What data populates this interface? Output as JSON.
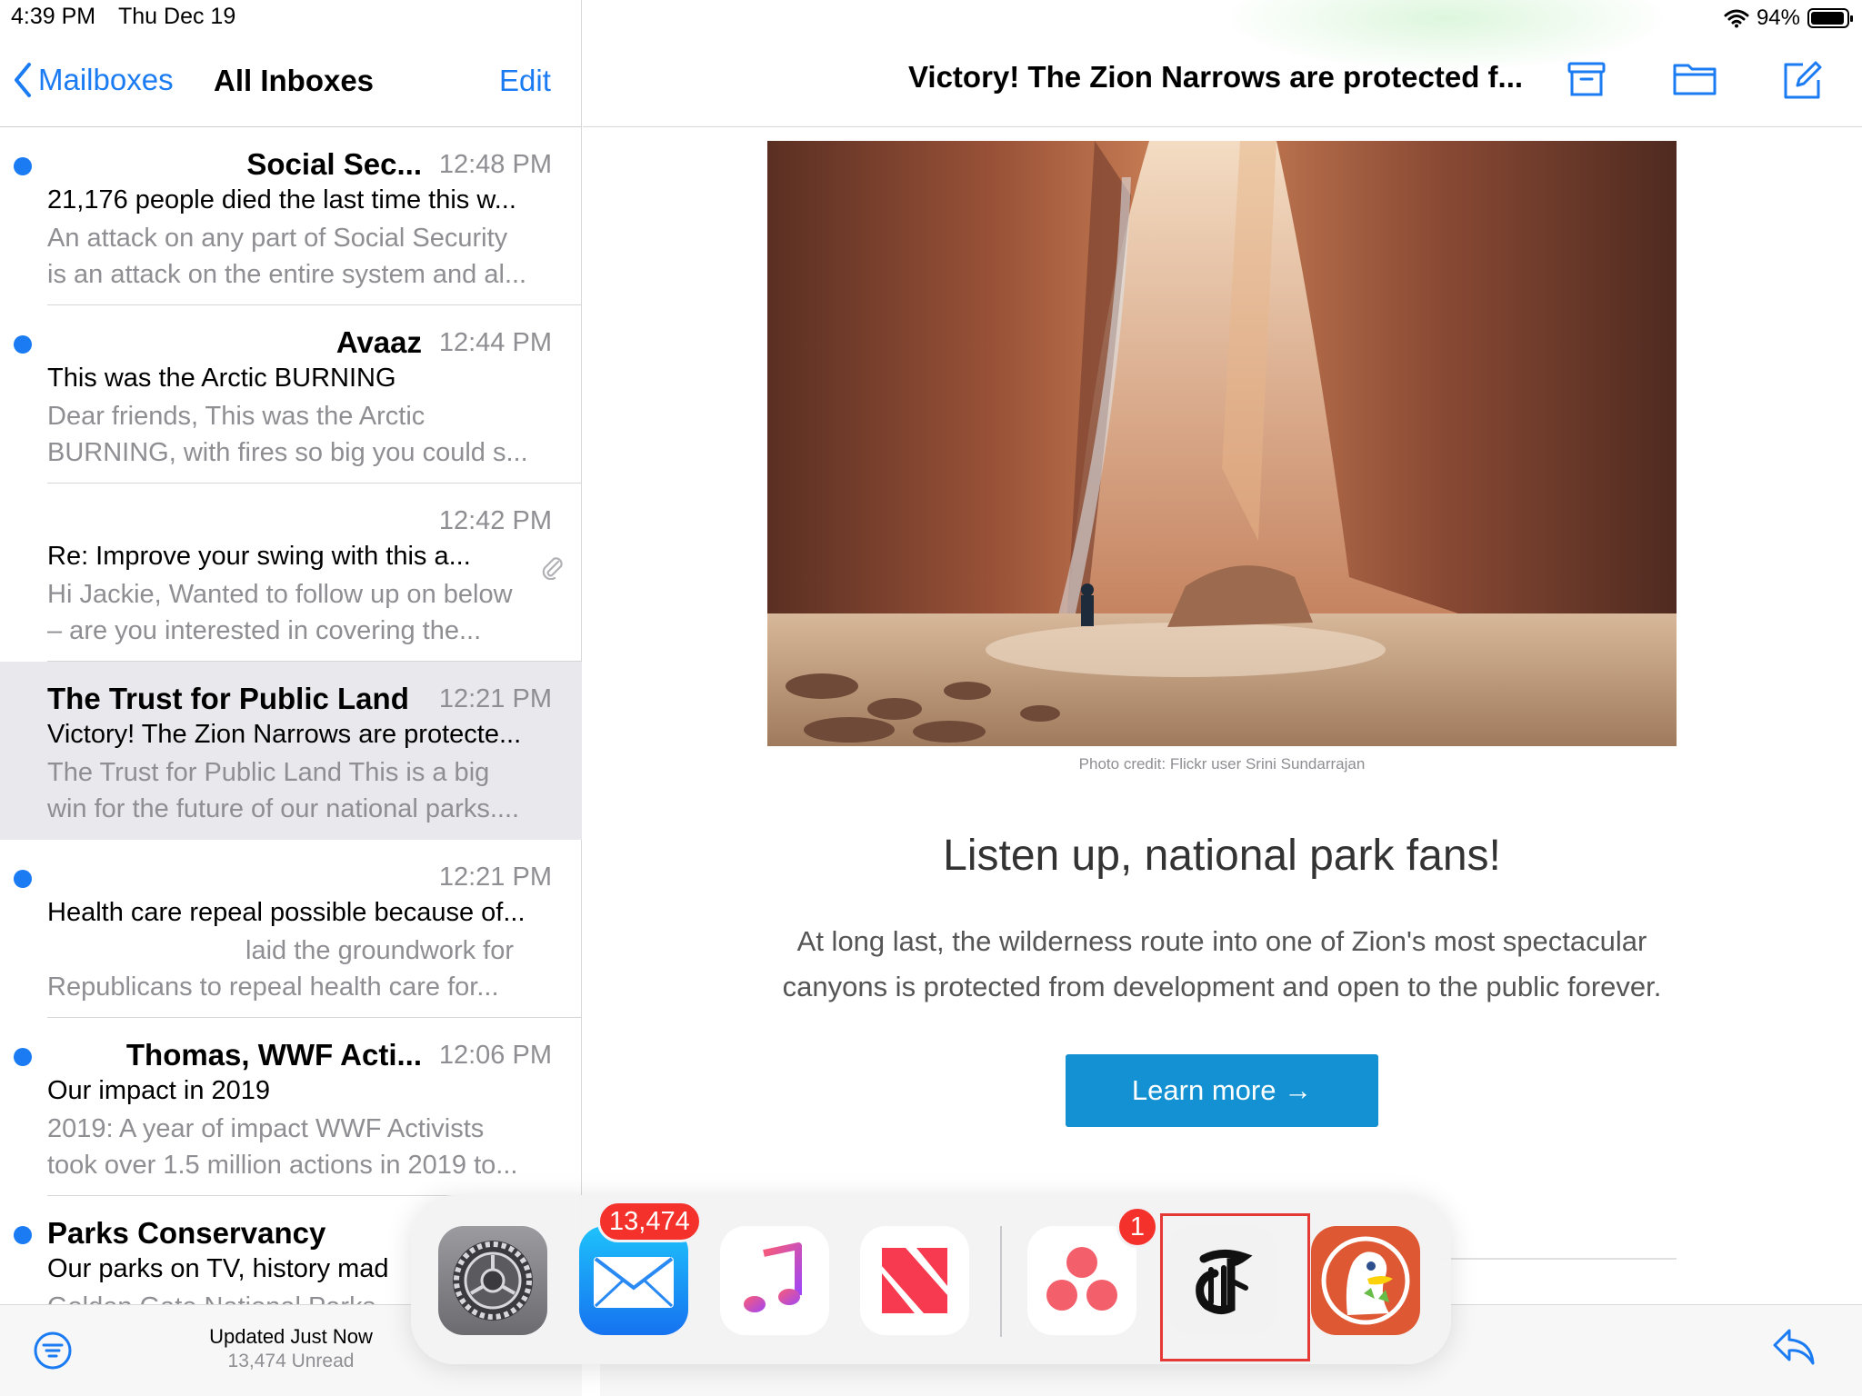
{
  "status_bar": {
    "time": "4:39 PM",
    "date": "Thu Dec 19",
    "battery": "94%"
  },
  "sidebar_nav": {
    "back_label": "Mailboxes",
    "title": "All Inboxes",
    "edit_label": "Edit"
  },
  "mails": [
    {
      "sender": "Social Sec...",
      "time": "12:48 PM",
      "subject": "21,176 people died the last time this w...",
      "preview_1": "An attack on any part of Social Security",
      "preview_2": "is an attack on the entire system and al...",
      "unread": true
    },
    {
      "sender": "Avaaz",
      "time": "12:44 PM",
      "subject": "This was the Arctic BURNING",
      "preview_1": "Dear friends, This was the Arctic",
      "preview_2": "BURNING, with fires so big you could s...",
      "unread": true
    },
    {
      "sender": "",
      "time": "12:42 PM",
      "subject": "Re:  Improve your swing with this a...",
      "preview_1": "Hi Jackie, Wanted to follow up on below",
      "preview_2": "– are you interested in covering the...",
      "unread": false
    },
    {
      "sender": "The Trust for Public Land",
      "time": "12:21 PM",
      "subject": "Victory! The Zion Narrows are protecte...",
      "preview_1": "The Trust for Public Land This is a big",
      "preview_2": "win for the future of our national parks....",
      "unread": false
    },
    {
      "sender": "",
      "time": "12:21 PM",
      "subject": "Health care repeal possible because of...",
      "preview_1": "laid the groundwork for",
      "preview_2": "Republicans to repeal health care for...",
      "unread": true
    },
    {
      "sender": "Thomas, WWF Acti...",
      "time": "12:06 PM",
      "subject": "Our impact in 2019",
      "preview_1": "2019: A year of impact WWF Activists",
      "preview_2": "took over 1.5 million actions in 2019 to...",
      "unread": true
    },
    {
      "sender": "Parks Conservancy",
      "time": "",
      "subject": "Our parks on TV, history mad",
      "preview_1": "Golden Gate National Parks",
      "preview_2": "",
      "unread": true
    }
  ],
  "sidebar_toolbar": {
    "updated": "Updated Just Now",
    "unread": "13,474 Unread"
  },
  "detail": {
    "title": "Victory! The Zion Narrows are protected f...",
    "photo_credit": "Photo credit: Flickr user Srini Sundarrajan",
    "headline": "Listen up, national park fans!",
    "body_line_1": "At long last, the wilderness route into one of Zion's most spectacular",
    "body_line_2": "canyons is protected from development and open to the public forever.",
    "cta": "Learn more →"
  },
  "dock": {
    "mail_badge": "13,474",
    "asana_badge": "1",
    "apps": [
      "Settings",
      "Mail",
      "Music",
      "News",
      "Asana",
      "The New York Times",
      "DuckDuckGo"
    ]
  },
  "colors": {
    "accent": "#1a7bf2",
    "cta": "#1391d2",
    "badge": "#f5312b",
    "highlight": "#e53935"
  }
}
